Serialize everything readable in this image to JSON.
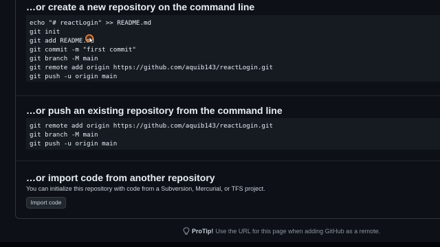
{
  "sections": {
    "create": {
      "title": "…or create a new repository on the command line",
      "lines": [
        "echo \"# reactLogin\" >> README.md",
        "git init",
        "git add README.md",
        "git commit -m \"first commit\"",
        "git branch -M main",
        "git remote add origin https://github.com/aquib143/reactLogin.git",
        "git push -u origin main"
      ]
    },
    "push": {
      "title": "…or push an existing repository from the command line",
      "lines": [
        "git remote add origin https://github.com/aquib143/reactLogin.git",
        "git branch -M main",
        "git push -u origin main"
      ]
    },
    "import": {
      "title": "…or import code from another repository",
      "description": "You can initialize this repository with code from a Subversion, Mercurial, or TFS project.",
      "button_label": "Import code"
    }
  },
  "protip": {
    "icon": "light-bulb-icon",
    "label": "ProTip!",
    "text": "Use the URL for this page when adding GitHub as a remote."
  },
  "colors": {
    "background": "#0d1117",
    "code_background": "#161b22",
    "border": "#30363d",
    "cursor_ring": "#f0883e"
  }
}
